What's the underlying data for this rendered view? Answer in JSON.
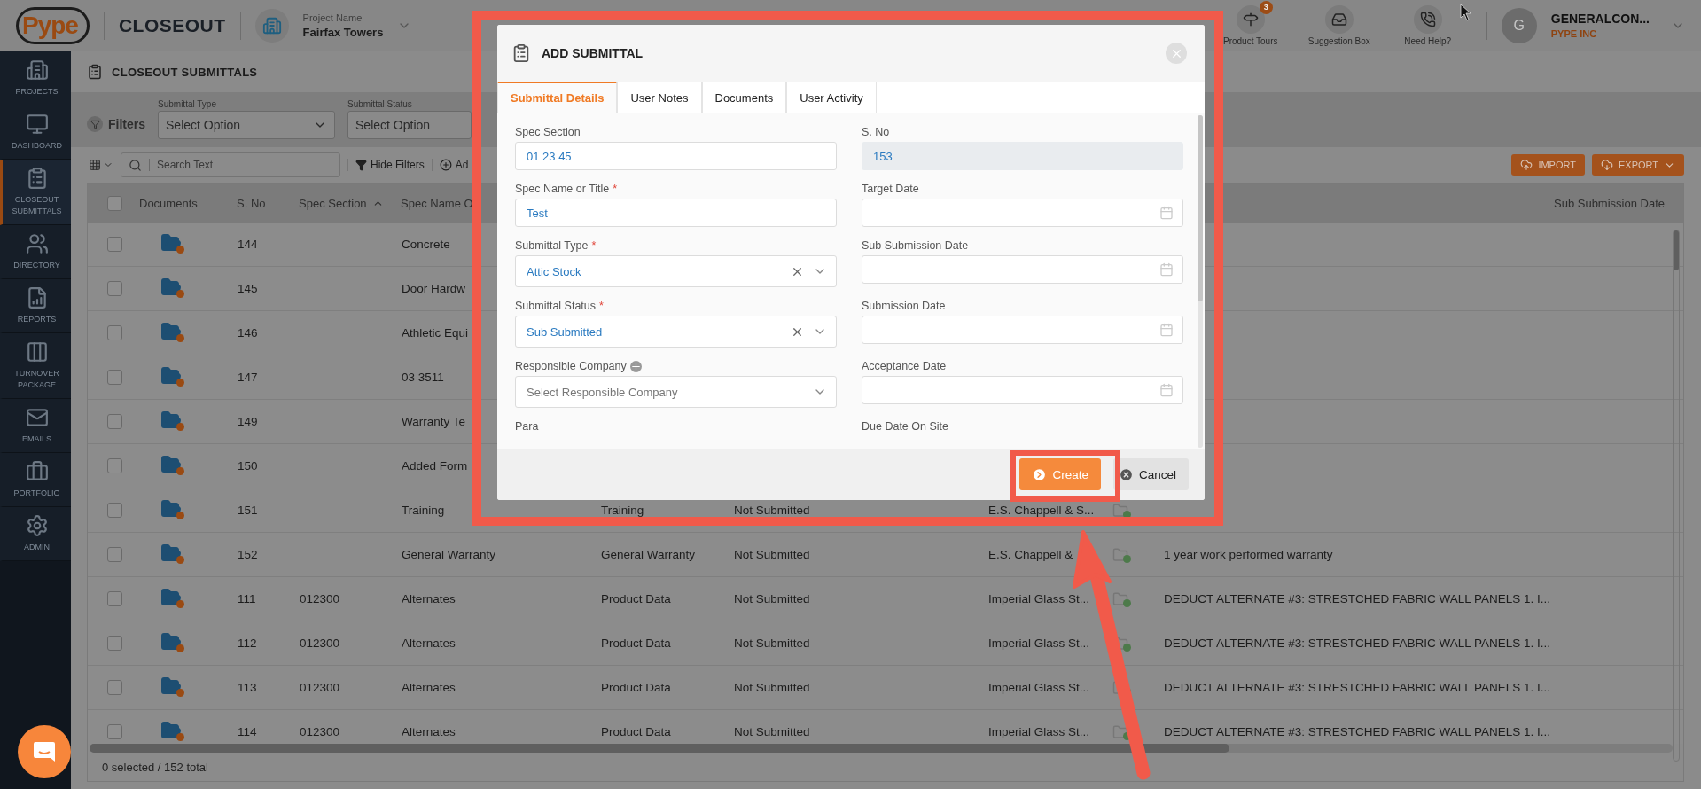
{
  "header": {
    "logo": "Pype",
    "app": "CLOSEOUT",
    "project_label": "Project Name",
    "project": "Fairfax Towers",
    "actions": [
      {
        "kind": "tours",
        "label": "Product Tours",
        "badge": "3"
      },
      {
        "kind": "suggestion",
        "label": "Suggestion Box"
      },
      {
        "kind": "help",
        "label": "Need Help?"
      }
    ],
    "user": {
      "initial": "G",
      "name": "GENERALCON...",
      "company": "PYPE INC"
    }
  },
  "sidebar": [
    {
      "kind": "projects",
      "label": "PROJECTS",
      "selected": false
    },
    {
      "kind": "dashboard",
      "label": "DASHBOARD",
      "selected": false
    },
    {
      "kind": "closeout",
      "label": "CLOSEOUT SUBMITTALS",
      "selected": true
    },
    {
      "kind": "directory",
      "label": "DIRECTORY",
      "selected": false
    },
    {
      "kind": "reports",
      "label": "REPORTS",
      "selected": false
    },
    {
      "kind": "turnover",
      "label": "TURNOVER PACKAGE",
      "selected": false
    },
    {
      "kind": "emails",
      "label": "EMAILS",
      "selected": false
    },
    {
      "kind": "portfolio",
      "label": "PORTFOLIO",
      "selected": false
    },
    {
      "kind": "admin",
      "label": "ADMIN",
      "selected": false
    }
  ],
  "page_title": "CLOSEOUT SUBMITTALS",
  "filters": {
    "label": "Filters",
    "fields": [
      {
        "label": "Submittal Type",
        "placeholder": "Select Option"
      },
      {
        "label": "Submittal Status",
        "placeholder": "Select Option"
      }
    ]
  },
  "toolbar": {
    "search_placeholder": "Search Text",
    "hide_filters": "Hide Filters",
    "add": "Ad",
    "import": "IMPORT",
    "export": "EXPORT"
  },
  "table": {
    "columns": [
      {
        "label": "Documents",
        "sorted": false
      },
      {
        "label": "S. No",
        "sorted": false
      },
      {
        "label": "Spec Section",
        "sorted": true
      },
      {
        "label": "Spec Name O",
        "sorted": false
      }
    ],
    "last_column": "Sub Submission Date",
    "all_checked": false,
    "rows": [
      {
        "checked": false,
        "sno": "144",
        "spec_name": "Concrete"
      },
      {
        "checked": false,
        "sno": "145",
        "spec_name": "Door Hardw"
      },
      {
        "checked": false,
        "sno": "146",
        "spec_name": "Athletic Equi"
      },
      {
        "checked": false,
        "sno": "147",
        "spec_name": "03 3511"
      },
      {
        "checked": false,
        "sno": "149",
        "spec_name": "Warranty Te"
      },
      {
        "checked": false,
        "sno": "150",
        "spec_name": "Added Form"
      },
      {
        "checked": false,
        "sno": "151",
        "spec_name": "Training",
        "type": "Training",
        "status": "Not Submitted",
        "company": "E.S. Chappell & S..."
      },
      {
        "checked": false,
        "sno": "152",
        "spec_name": "General Warranty",
        "type": "General Warranty",
        "status": "Not Submitted",
        "company": "E.S. Chappell &",
        "description": "1 year work performed warranty"
      },
      {
        "checked": false,
        "sno": "111",
        "spec_section": "012300",
        "spec_name": "Alternates",
        "type": "Product Data",
        "status": "Not Submitted",
        "company": "Imperial Glass St...",
        "description": "DEDUCT ALTERNATE #3: STRESTCHED FABRIC WALL PANELS 1. I..."
      },
      {
        "checked": false,
        "sno": "112",
        "spec_section": "012300",
        "spec_name": "Alternates",
        "type": "Product Data",
        "status": "Not Submitted",
        "company": "Imperial Glass St...",
        "description": "DEDUCT ALTERNATE #3: STRESTCHED FABRIC WALL PANELS 1. I..."
      },
      {
        "checked": false,
        "sno": "113",
        "spec_section": "012300",
        "spec_name": "Alternates",
        "type": "Product Data",
        "status": "Not Submitted",
        "company": "Imperial Glass St...",
        "description": "DEDUCT ALTERNATE #3: STRESTCHED FABRIC WALL PANELS 1. I..."
      },
      {
        "checked": false,
        "sno": "114",
        "spec_section": "012300",
        "spec_name": "Alternates",
        "type": "Product Data",
        "status": "Not Submitted",
        "company": "Imperial Glass St...",
        "description": "DEDUCT ALTERNATE #3: STRESTCHED FABRIC WALL PANELS 1. I..."
      }
    ],
    "footer": "0 selected / 152 total"
  },
  "modal": {
    "title": "ADD SUBMITTAL",
    "tabs": [
      {
        "label": "Submittal Details",
        "selected": true
      },
      {
        "label": "User Notes",
        "selected": false
      },
      {
        "label": "Documents",
        "selected": false
      },
      {
        "label": "User Activity",
        "selected": false
      }
    ],
    "fields": [
      {
        "kind": "text",
        "label": "Spec Section",
        "disabled": false,
        "value": "01 23 45"
      },
      {
        "kind": "text",
        "label": "S. No",
        "disabled": true,
        "value": "153"
      },
      {
        "kind": "text",
        "label": "Spec Name or Title",
        "required_mark": "*",
        "disabled": false,
        "value": "Test"
      },
      {
        "kind": "date",
        "label": "Target Date",
        "disabled": false
      },
      {
        "kind": "select",
        "label": "Submittal Type",
        "required_mark": "*",
        "disabled": false,
        "value": "Attic Stock"
      },
      {
        "kind": "date",
        "label": "Sub Submission Date",
        "disabled": false
      },
      {
        "kind": "select",
        "label": "Submittal Status",
        "required_mark": "*",
        "disabled": false,
        "value": "Sub Submitted"
      },
      {
        "kind": "date",
        "label": "Submission Date",
        "disabled": false
      },
      {
        "kind": "select",
        "label": "Responsible Company",
        "disabled": false,
        "add_button": true,
        "placeholder": "Select Responsible Company"
      },
      {
        "kind": "date",
        "label": "Acceptance Date",
        "disabled": false
      },
      {
        "kind": "label",
        "label": "Para"
      },
      {
        "kind": "label",
        "label": "Due Date On Site"
      }
    ],
    "create": "Create",
    "cancel": "Cancel"
  }
}
